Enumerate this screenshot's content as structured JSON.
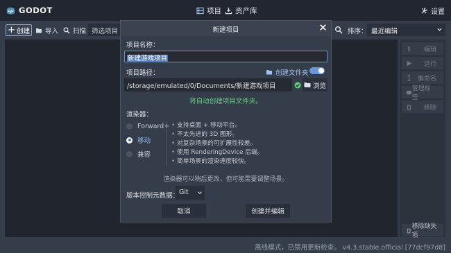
{
  "app": {
    "logo_text": "GODOT",
    "tabs": [
      {
        "label": "项目",
        "icon": "project-list-icon"
      },
      {
        "label": "资产库",
        "icon": "asset-library-icon"
      }
    ],
    "settings_label": "设置"
  },
  "toolbar": {
    "create_label": "创建",
    "import_label": "导入",
    "scan_label": "扫描",
    "filter_placeholder": "筛选项目",
    "sort_label": "排序：",
    "sort_value": "最近编辑"
  },
  "side_panel": {
    "edit_label": "编辑",
    "run_label": "运行",
    "rename_label": "重命名",
    "manage_tags_label": "管理标签",
    "remove_label": "移除",
    "remove_missing_label": "移除缺失项"
  },
  "status_text": "离线模式，已禁用更新检查。  v4.3.stable.official [77dcf97d8]",
  "dialog": {
    "title": "新建项目",
    "project_name_label": "项目名称：",
    "project_name_value": "新建游戏项目",
    "project_path_label": "项目路径：",
    "create_folder_label": "创建文件夹",
    "create_folder_enabled": true,
    "project_path_value": "/storage/emulated/0/Documents/新建游戏项目",
    "browse_label": "浏览",
    "path_status": "将自动创建项目文件夹。",
    "renderer_label": "渲染器：",
    "renderer_options": [
      {
        "label": "Forward+",
        "selected": false
      },
      {
        "label": "移动",
        "selected": true
      },
      {
        "label": "兼容",
        "selected": false
      }
    ],
    "renderer_description": [
      "支持桌面 + 移动平台。",
      "不太先进的 3D 图形。",
      "对复杂场景的可扩展性较差。",
      "使用 RenderingDevice 后端。",
      "简单场景的渲染速度较快。"
    ],
    "renderer_note": "渲染器可以稍后更改，但可能需要调整场景。",
    "vcs_label": "版本控制元数据：",
    "vcs_value": "Git",
    "cancel_label": "取消",
    "create_edit_label": "创建并编辑"
  },
  "colors": {
    "accent": "#6a97d8",
    "success": "#5fd07b",
    "background": "#363d4a",
    "topbar": "#212630"
  }
}
